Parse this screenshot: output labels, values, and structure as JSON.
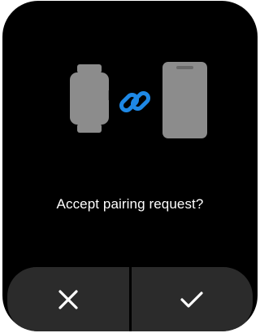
{
  "dialog": {
    "message": "Accept pairing request?"
  },
  "illustration": {
    "left_icon": "smartwatch-icon",
    "center_icon": "link-icon",
    "right_icon": "smartphone-icon",
    "link_color": "#1e88e5"
  },
  "actions": {
    "decline_icon": "close-icon",
    "accept_icon": "checkmark-icon"
  },
  "colors": {
    "background": "#000000",
    "button_background": "#2b2b2b",
    "device_icon_fill": "#8c8c8c",
    "text": "#ffffff"
  }
}
